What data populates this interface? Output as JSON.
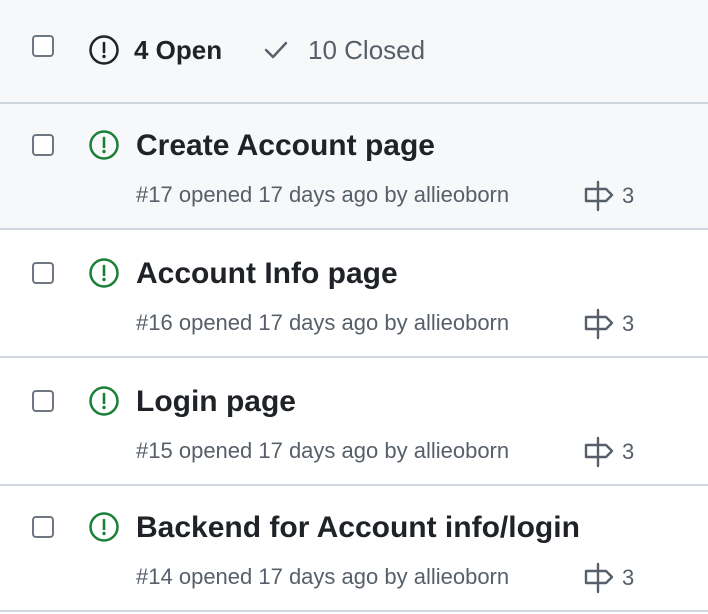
{
  "header": {
    "open_label": "4 Open",
    "closed_label": "10 Closed"
  },
  "issues": [
    {
      "title": "Create Account page",
      "number": "#17",
      "opened": "opened 17 days ago by",
      "author": "allieoborn",
      "comments": "3"
    },
    {
      "title": "Account Info page",
      "number": "#16",
      "opened": "opened 17 days ago by",
      "author": "allieoborn",
      "comments": "3"
    },
    {
      "title": "Login page",
      "number": "#15",
      "opened": "opened 17 days ago by",
      "author": "allieoborn",
      "comments": "3"
    },
    {
      "title": "Backend for Account info/login",
      "number": "#14",
      "opened": "opened 17 days ago by",
      "author": "allieoborn",
      "comments": "3"
    }
  ],
  "colors": {
    "open_green": "#1a7f37",
    "muted": "#57606a",
    "header_bg": "#f6f8fa",
    "border": "#d0d7de"
  },
  "icons": {
    "open_state": "issue-opened-icon",
    "closed_state": "check-icon",
    "comments": "signpost-icon"
  }
}
